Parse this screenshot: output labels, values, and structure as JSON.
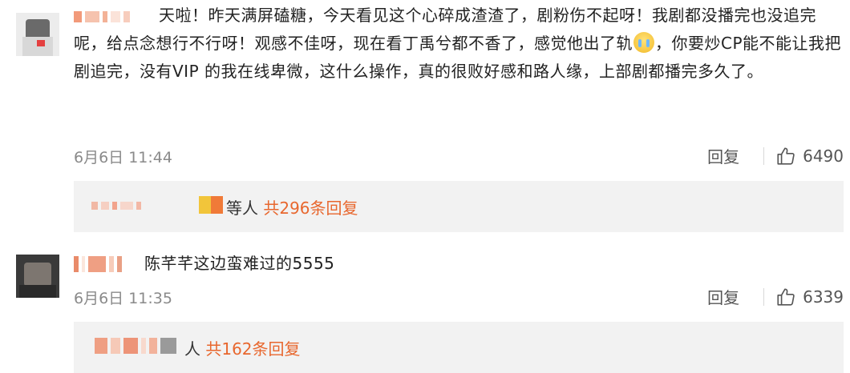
{
  "comments": [
    {
      "text_before_emoji": "天啦！昨天满屏磕糖，今天看见这个心碎成渣渣了，剧粉伤不起呀！我剧都没播完也没追完呢，给点念想行不行呀！观感不佳呀，现在看丁禹兮都不香了，感觉他出了轨",
      "emoji": "cry-emoji",
      "text_after_emoji": "，你要炒CP能不能让我把剧追完，没有VIP 的我在线卑微，这什么操作，真的很败好感和路人缘，上部剧都播完多久了。",
      "time": "6月6日 11:44",
      "reply_label": "回复",
      "likes": "6490",
      "replies_suffix": "等人",
      "replies_count": "共296条回复"
    },
    {
      "text": "陈芊芊这边蛮难过的5555",
      "time": "6月6日 11:35",
      "reply_label": "回复",
      "likes": "6339",
      "replies_suffix": "人",
      "replies_count": "共162条回复"
    }
  ],
  "colors": {
    "accent": "#e8672e",
    "time": "#8a8a8a",
    "reply_bg": "#f2f2f2"
  }
}
